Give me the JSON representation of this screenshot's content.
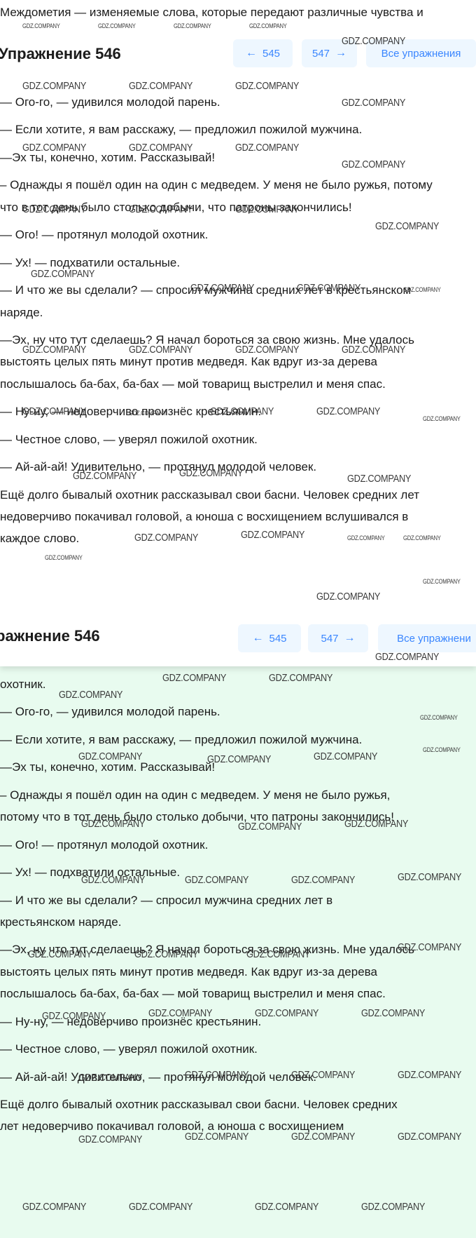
{
  "intro": "Междометия — изменяемые слова, которые передают различные чувства и",
  "toolbar_top": {
    "title": "Упражнение 546",
    "prev_label": "545",
    "next_label": "547",
    "all_label": "Все упражнения"
  },
  "toolbar_bottom": {
    "title": "ражнение 546",
    "prev_label": "545",
    "next_label": "547",
    "all_label": "Все упражнени"
  },
  "top_lines": [
    "— Ого-го, — удивился молодой парень.",
    "— Если хотите, я вам расскажу, — предложил пожилой мужчина.",
    "—Эх ты, конечно, хотим. Рассказывай!",
    "– Однажды я пошёл один на один с медведем. У меня не было ружья, потому",
    "что в тот день было столько добычи, что патроны закончились!",
    "— Ого! — протянул молодой охотник.",
    "— Ух! — подхватили остальные.",
    "— И что же вы сделали? — спросил мужчина средних лет в крестьянском",
    "наряде.",
    "—Эх, ну что тут сделаешь? Я начал бороться за свою жизнь. Мне удалось",
    "выстоять целых пять минут против медведя. Как вдруг из-за дерева",
    "послышалось ба-бах, ба-бах — мой товарищ выстрелил и меня спас.",
    "— Ну-ну, — недоверчиво произнёс крестьянин.",
    "— Честное слово, — уверял пожилой охотник.",
    "— Ай-ай-ай! Удивительно, — протянул молодой человек.",
    "Ещё долго бывалый охотник рассказывал свои басни. Человек средних лет",
    "недоверчиво покачивал головой, а юноша с восхищением вслушивался в",
    "каждое слово."
  ],
  "bottom_lines": [
    "охотник.",
    "— Ого-го, — удивился молодой парень.",
    "— Если хотите, я вам расскажу, — предложил пожилой мужчина.",
    "—Эх ты, конечно, хотим. Рассказывай!",
    "– Однажды я пошёл один на один с медведем. У меня не было ружья,",
    "потому что в тот день было столько добычи, что патроны закончились!",
    "— Ого! — протянул молодой охотник.",
    "— Ух! — подхватили остальные.",
    "— И что же вы сделали? — спросил мужчина средних лет в",
    "крестьянском наряде.",
    "—Эх, ну что тут сделаешь? Я начал бороться за свою жизнь. Мне удалось",
    "выстоять целых пять минут против медведя. Как вдруг из-за дерева",
    "послышалось ба-бах, ба-бах — мой товарищ выстрелил и меня спас.",
    "— Ну-ну, — недоверчиво произнёс крестьянин.",
    "— Честное слово, — уверял пожилой охотник.",
    "— Ай-ай-ай! Удивительно, — протянул молодой человек.",
    "Ещё долго бывалый охотник рассказывал свои басни. Человек средних",
    "лет недоверчиво покачивал головой, а юноша с восхищением"
  ],
  "watermark": "GDZ.COMPANY",
  "icons": {
    "prev": "arrow-left-icon",
    "next": "arrow-right-icon"
  },
  "colors": {
    "accent": "#3a86ff",
    "button_bg": "#eef7ff",
    "bottom_bg": "#e8fbef"
  }
}
